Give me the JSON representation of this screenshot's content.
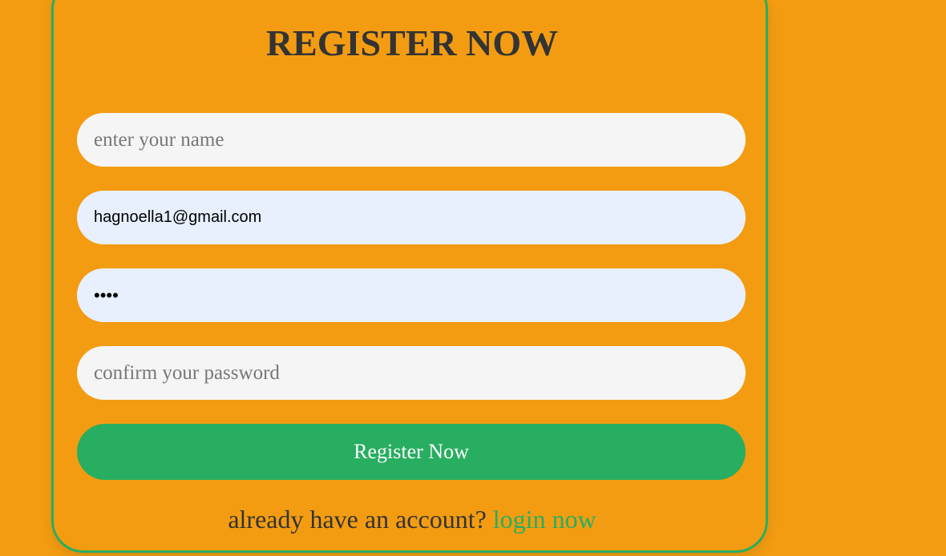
{
  "form": {
    "title": "REGISTER NOW",
    "name_placeholder": "enter your name",
    "email_value": "hagnoella1@gmail.com",
    "password_value": "••••",
    "confirm_placeholder": "confirm your password",
    "submit_label": "Register Now"
  },
  "footer": {
    "prompt": "already have an account?",
    "login_link": "login now"
  },
  "colors": {
    "background": "#f39c12",
    "accent": "#27ae60",
    "input_bg": "#f5f5f5",
    "autofill_bg": "#e8f0fe",
    "text": "#333333"
  }
}
